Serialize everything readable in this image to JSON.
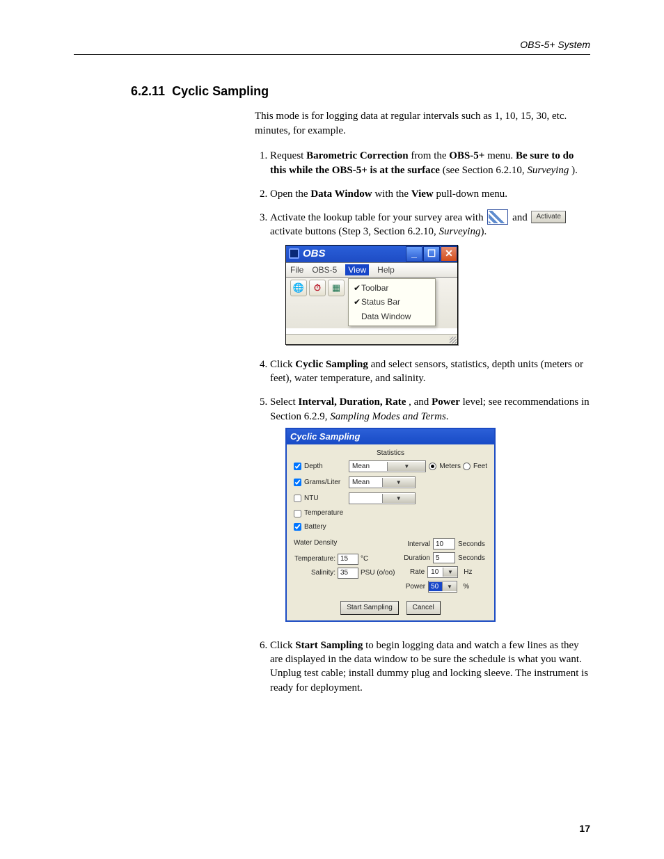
{
  "header": {
    "doc_title": "OBS-5+ System"
  },
  "section": {
    "number": "6.2.11",
    "title": "Cyclic Sampling",
    "lead": "This mode is for logging data at regular intervals such as 1, 10, 15, 30, etc. minutes, for example."
  },
  "steps": [
    {
      "a": "Request ",
      "b": "Barometric Correction",
      "c": " from the ",
      "d": "OBS-5+",
      "e": " menu.  ",
      "f": "Be sure to do this while the OBS-5+ is at the surface",
      "g": " (see Section 6.2.10, ",
      "h": "Surveying",
      "i": " )."
    },
    {
      "a": "Open the ",
      "b": "Data Window",
      "c": " with the ",
      "d": "View",
      "e": " pull-down menu."
    },
    {
      "a": "Activate the lookup table for your survey area with ",
      "b": " and ",
      "btn": "Activate",
      "c": " activate buttons (Step 3, Section 6.2.10, ",
      "d": "Surveying",
      "e": ")."
    },
    {
      "a": "Click ",
      "b": "Cyclic Sampling",
      "c": " and select sensors, statistics, depth units (meters or feet), water temperature, and salinity."
    },
    {
      "a": "Select ",
      "b": "Interval, Duration, Rate",
      "c": ", and ",
      "d": "Power",
      "e": " level; see recommendations in Section 6.2.9, ",
      "f": "Sampling Modes and Terms",
      "g": "."
    },
    {
      "a": "Click ",
      "b": "Start Sampling",
      "c": " to begin logging data and watch a few lines as they are displayed in the data window to be sure the schedule is what you want.  Unplug test cable; install dummy plug and locking sleeve. The instrument is ready for deployment."
    }
  ],
  "fig1": {
    "title": "OBS",
    "menu": [
      "File",
      "OBS-5",
      "View",
      "Help"
    ],
    "drop": [
      "Toolbar",
      "Status Bar",
      "Data Window"
    ]
  },
  "fig2": {
    "title": "Cyclic Sampling",
    "statistics_label": "Statistics",
    "sensors": [
      "Depth",
      "Grams/Liter",
      "NTU",
      "Temperature",
      "Battery"
    ],
    "stat_val": "Mean",
    "units": [
      "Meters",
      "Feet"
    ],
    "water_density": "Water Density",
    "temp_label": "Temperature:",
    "temp_val": "15",
    "temp_unit": "°C",
    "sal_label": "Salinity:",
    "sal_val": "35",
    "sal_unit": "PSU (o/oo)",
    "params": [
      {
        "name": "Interval",
        "val": "10",
        "unit": "Seconds"
      },
      {
        "name": "Duration",
        "val": "5",
        "unit": "Seconds"
      },
      {
        "name": "Rate",
        "val": "10",
        "unit": "Hz"
      },
      {
        "name": "Power",
        "val": "50",
        "unit": "%"
      }
    ],
    "buttons": [
      "Start Sampling",
      "Cancel"
    ]
  },
  "footer": {
    "page": "17"
  }
}
